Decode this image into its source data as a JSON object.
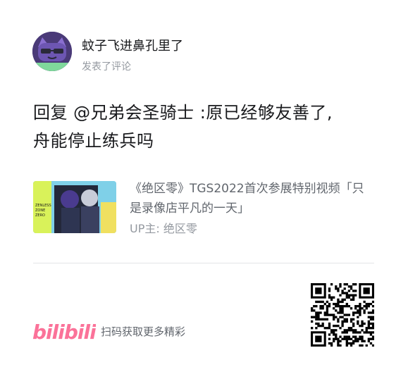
{
  "user": {
    "name": "蚊子飞进鼻孔里了",
    "action": "发表了评论"
  },
  "comment": {
    "line1": "回复 @兄弟会圣骑士 :原已经够友善了,",
    "line2": "舟能停止练兵吗"
  },
  "video": {
    "title": "《绝区零》TGS2022首次参展特别视频「只是录像店平凡的一天」",
    "up": "UP主: 绝区零",
    "thumb_text": "ZENLESS ZONE ZERO"
  },
  "footer": {
    "logo_text": "bilibili",
    "slogan": "扫码获取更多精彩"
  },
  "colors": {
    "brand_pink": "#fb7299",
    "text": "#18191c",
    "muted": "#9499a0"
  }
}
